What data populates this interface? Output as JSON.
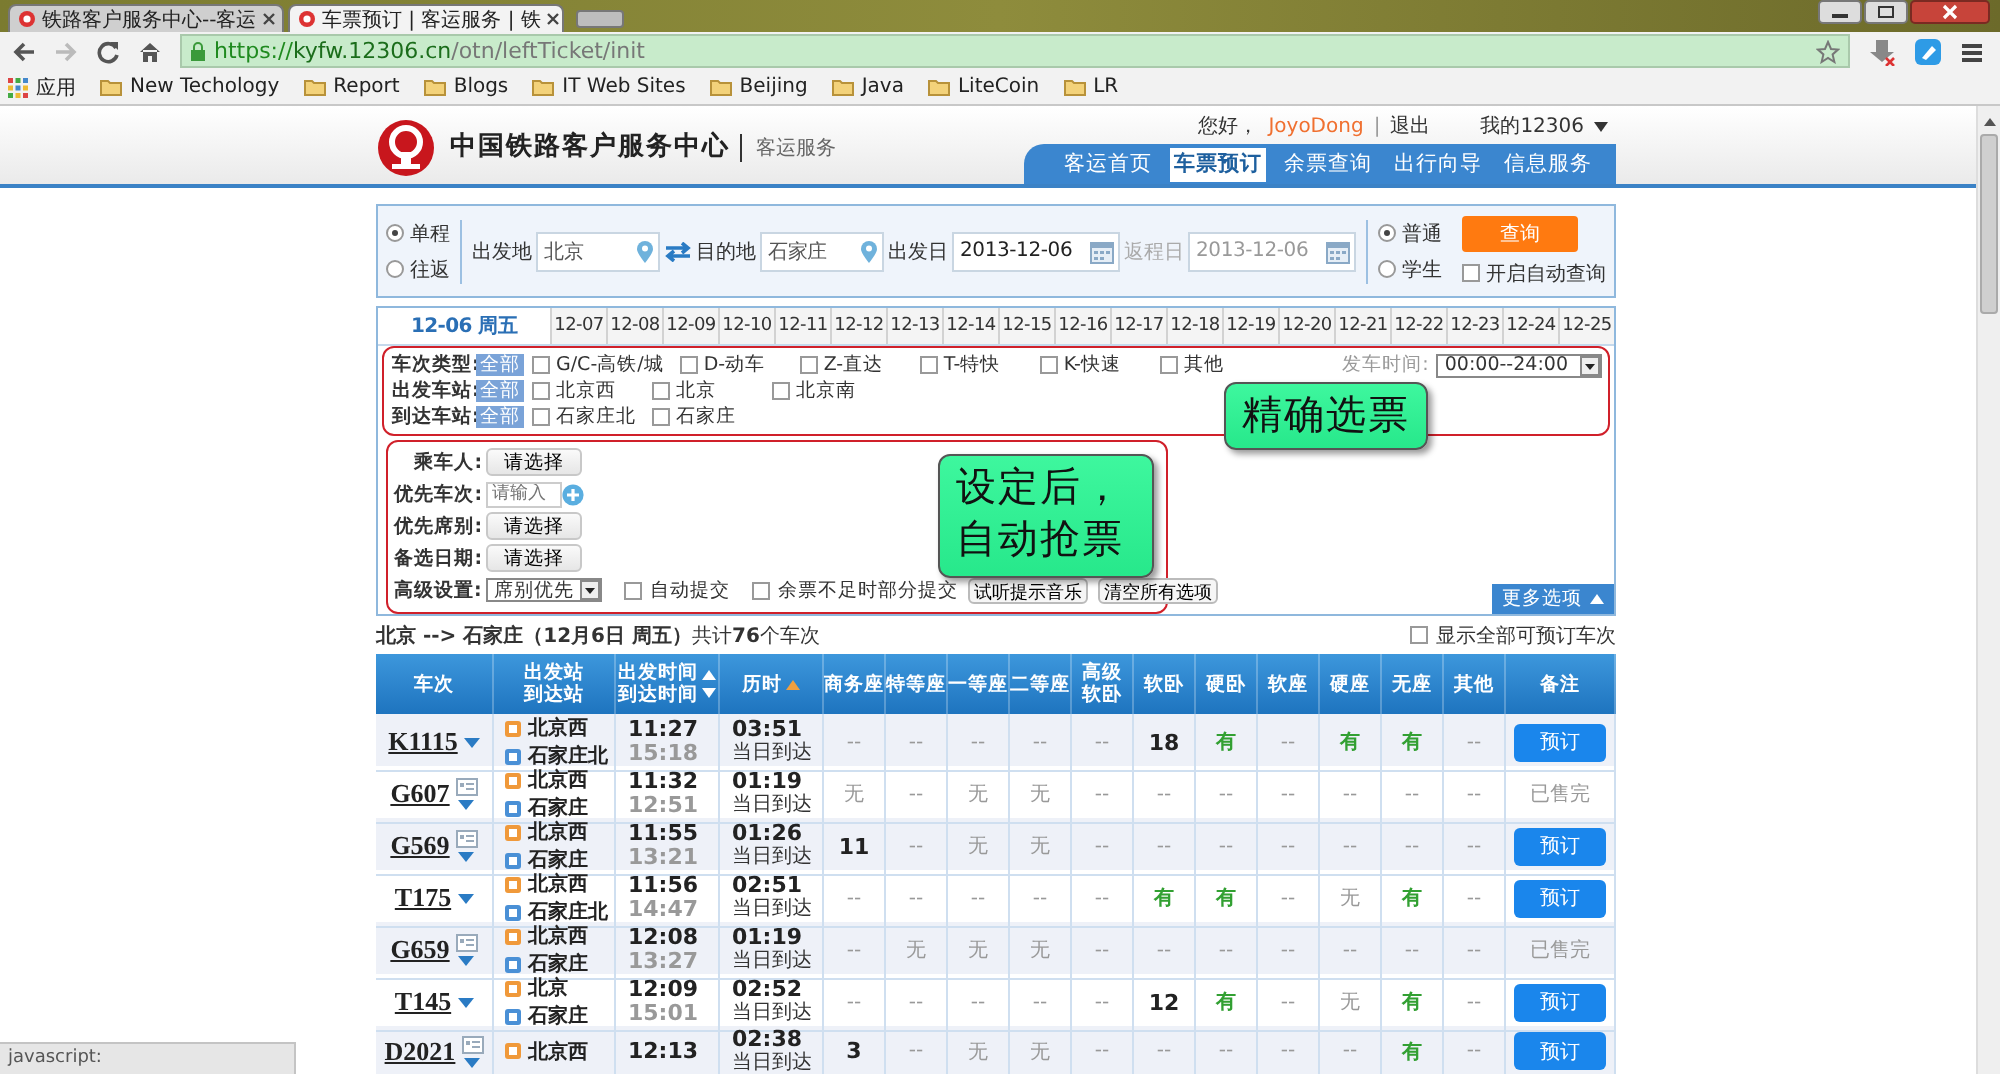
{
  "browser": {
    "tabs": [
      {
        "title": "铁路客户服务中心--客运",
        "selected": false
      },
      {
        "title": "车票预订 | 客运服务 | 铁",
        "selected": true
      }
    ],
    "url": {
      "scheme": "https://",
      "host": "kyfw.12306.cn",
      "path": "/otn/leftTicket/init"
    },
    "bookmarks": [
      "应用",
      "New Techology",
      "Report",
      "Blogs",
      "IT Web Sites",
      "Beijing",
      "Java",
      "LiteCoin",
      "LR"
    ]
  },
  "header": {
    "site_name": "中国铁路客户服务中心",
    "section": "客运服务",
    "greeting": "您好，",
    "user": "JoyoDong",
    "separator": "|",
    "logout": "退出",
    "account": "我的12306",
    "nav": [
      {
        "label": "客运首页",
        "selected": false
      },
      {
        "label": "车票预订",
        "selected": true
      },
      {
        "label": "余票查询",
        "selected": false
      },
      {
        "label": "出行向导",
        "selected": false
      },
      {
        "label": "信息服务",
        "selected": false
      }
    ]
  },
  "search": {
    "trip_types": [
      {
        "label": "单程",
        "selected": true
      },
      {
        "label": "往返",
        "selected": false
      }
    ],
    "from": {
      "label": "出发地",
      "value": "北京"
    },
    "to": {
      "label": "目的地",
      "value": "石家庄"
    },
    "depart_date": {
      "label": "出发日",
      "value": "2013-12-06",
      "disabled": false
    },
    "return_date": {
      "label": "返程日",
      "value": "2013-12-06",
      "disabled": true
    },
    "passenger_types": [
      {
        "label": "普通",
        "selected": true
      },
      {
        "label": "学生",
        "selected": false
      }
    ],
    "query_button": "查询",
    "auto_query": {
      "label": "开启自动查询",
      "checked": false
    }
  },
  "dates": [
    {
      "label": "12-06 周五",
      "selected": true
    },
    {
      "label": "12-07",
      "selected": false
    },
    {
      "label": "12-08",
      "selected": false
    },
    {
      "label": "12-09",
      "selected": false
    },
    {
      "label": "12-10",
      "selected": false
    },
    {
      "label": "12-11",
      "selected": false
    },
    {
      "label": "12-12",
      "selected": false
    },
    {
      "label": "12-13",
      "selected": false
    },
    {
      "label": "12-14",
      "selected": false
    },
    {
      "label": "12-15",
      "selected": false
    },
    {
      "label": "12-16",
      "selected": false
    },
    {
      "label": "12-17",
      "selected": false
    },
    {
      "label": "12-18",
      "selected": false
    },
    {
      "label": "12-19",
      "selected": false
    },
    {
      "label": "12-20",
      "selected": false
    },
    {
      "label": "12-21",
      "selected": false
    },
    {
      "label": "12-22",
      "selected": false
    },
    {
      "label": "12-23",
      "selected": false
    },
    {
      "label": "12-24",
      "selected": false
    },
    {
      "label": "12-25",
      "selected": false
    }
  ],
  "filters": {
    "highlighted": true,
    "callout": "精确选票",
    "rows": [
      {
        "label": "车次类型:",
        "all": "全部",
        "options": [
          {
            "label": "G/C-高铁/城",
            "checked": false
          },
          {
            "label": "D-动车",
            "checked": false
          },
          {
            "label": "Z-直达",
            "checked": false
          },
          {
            "label": "T-特快",
            "checked": false
          },
          {
            "label": "K-快速",
            "checked": false
          },
          {
            "label": "其他",
            "checked": false
          }
        ]
      },
      {
        "label": "出发车站:",
        "all": "全部",
        "options": [
          {
            "label": "北京西",
            "checked": false
          },
          {
            "label": "北京",
            "checked": false
          },
          {
            "label": "北京南",
            "checked": false
          }
        ]
      },
      {
        "label": "到达车站:",
        "all": "全部",
        "options": [
          {
            "label": "石家庄北",
            "checked": false
          },
          {
            "label": "石家庄",
            "checked": false
          }
        ]
      }
    ],
    "time": {
      "label": "发车时间:",
      "value": "00:00--24:00"
    }
  },
  "options": {
    "highlighted": true,
    "callout": [
      "设定后，",
      "自动抢票"
    ],
    "more": "更多选项",
    "rows": [
      {
        "kind": "button",
        "label": "乘车人:",
        "button": "请选择"
      },
      {
        "kind": "input",
        "label": "优先车次:",
        "placeholder": "请输入"
      },
      {
        "kind": "button",
        "label": "优先席别:",
        "button": "请选择"
      },
      {
        "kind": "button",
        "label": "备选日期:",
        "button": "请选择"
      },
      {
        "kind": "advanced",
        "label": "高级设置:",
        "select": "席别优先",
        "checks": [
          {
            "label": "自动提交",
            "checked": false
          },
          {
            "label": "余票不足时部分提交",
            "checked": false
          }
        ],
        "buttons": [
          "试听提示音乐",
          "清空所有选项"
        ]
      }
    ]
  },
  "route": {
    "summary": "**北京 --> 石家庄（12月6日  周五）**共计**76**个车次",
    "show_all": {
      "label": "显示全部可预订车次",
      "checked": false
    }
  },
  "table": {
    "columns": [
      {
        "lines": [
          "车次"
        ]
      },
      {
        "lines": [
          "出发站",
          "到达站"
        ]
      },
      {
        "lines": [
          "出发时间",
          "到达时间"
        ],
        "sort_up": true,
        "sort_down": true,
        "sort_active": false
      },
      {
        "lines": [
          "历时"
        ],
        "sort_up": true,
        "sort_active": true
      },
      {
        "lines": [
          "商务座"
        ]
      },
      {
        "lines": [
          "特等座"
        ]
      },
      {
        "lines": [
          "一等座"
        ]
      },
      {
        "lines": [
          "二等座"
        ]
      },
      {
        "lines": [
          "高级",
          "软卧"
        ]
      },
      {
        "lines": [
          "软卧"
        ]
      },
      {
        "lines": [
          "硬卧"
        ]
      },
      {
        "lines": [
          "软座"
        ]
      },
      {
        "lines": [
          "硬座"
        ]
      },
      {
        "lines": [
          "无座"
        ]
      },
      {
        "lines": [
          "其他"
        ]
      },
      {
        "lines": [
          "备注"
        ]
      }
    ],
    "rows": [
      {
        "train": "K1115",
        "stops_icon": false,
        "from": "北京西",
        "to": "石家庄北",
        "depart": "11:27",
        "arrive": "15:18",
        "duration": "03:51",
        "arrival_day": "当日到达",
        "seats": [
          {
            "text": "--",
            "kind": "none"
          },
          {
            "text": "--",
            "kind": "none"
          },
          {
            "text": "--",
            "kind": "none"
          },
          {
            "text": "--",
            "kind": "none"
          },
          {
            "text": "--",
            "kind": "none"
          },
          {
            "text": "18",
            "kind": "count"
          },
          {
            "text": "有",
            "kind": "yes"
          },
          {
            "text": "--",
            "kind": "none"
          },
          {
            "text": "有",
            "kind": "yes"
          },
          {
            "text": "有",
            "kind": "yes"
          },
          {
            "text": "--",
            "kind": "none"
          }
        ],
        "action": {
          "kind": "button",
          "text": "预订"
        }
      },
      {
        "train": "G607",
        "stops_icon": true,
        "from": "北京西",
        "to": "石家庄",
        "depart": "11:32",
        "arrive": "12:51",
        "duration": "01:19",
        "arrival_day": "当日到达",
        "seats": [
          {
            "text": "无",
            "kind": "none"
          },
          {
            "text": "--",
            "kind": "none"
          },
          {
            "text": "无",
            "kind": "none"
          },
          {
            "text": "无",
            "kind": "none"
          },
          {
            "text": "--",
            "kind": "none"
          },
          {
            "text": "--",
            "kind": "none"
          },
          {
            "text": "--",
            "kind": "none"
          },
          {
            "text": "--",
            "kind": "none"
          },
          {
            "text": "--",
            "kind": "none"
          },
          {
            "text": "--",
            "kind": "none"
          },
          {
            "text": "--",
            "kind": "none"
          }
        ],
        "action": {
          "kind": "sold_out",
          "text": "已售完"
        }
      },
      {
        "train": "G569",
        "stops_icon": true,
        "from": "北京西",
        "to": "石家庄",
        "depart": "11:55",
        "arrive": "13:21",
        "duration": "01:26",
        "arrival_day": "当日到达",
        "seats": [
          {
            "text": "11",
            "kind": "count"
          },
          {
            "text": "--",
            "kind": "none"
          },
          {
            "text": "无",
            "kind": "none"
          },
          {
            "text": "无",
            "kind": "none"
          },
          {
            "text": "--",
            "kind": "none"
          },
          {
            "text": "--",
            "kind": "none"
          },
          {
            "text": "--",
            "kind": "none"
          },
          {
            "text": "--",
            "kind": "none"
          },
          {
            "text": "--",
            "kind": "none"
          },
          {
            "text": "--",
            "kind": "none"
          },
          {
            "text": "--",
            "kind": "none"
          }
        ],
        "action": {
          "kind": "button",
          "text": "预订"
        }
      },
      {
        "train": "T175",
        "stops_icon": false,
        "from": "北京西",
        "to": "石家庄北",
        "depart": "11:56",
        "arrive": "14:47",
        "duration": "02:51",
        "arrival_day": "当日到达",
        "seats": [
          {
            "text": "--",
            "kind": "none"
          },
          {
            "text": "--",
            "kind": "none"
          },
          {
            "text": "--",
            "kind": "none"
          },
          {
            "text": "--",
            "kind": "none"
          },
          {
            "text": "--",
            "kind": "none"
          },
          {
            "text": "有",
            "kind": "yes"
          },
          {
            "text": "有",
            "kind": "yes"
          },
          {
            "text": "--",
            "kind": "none"
          },
          {
            "text": "无",
            "kind": "none"
          },
          {
            "text": "有",
            "kind": "yes"
          },
          {
            "text": "--",
            "kind": "none"
          }
        ],
        "action": {
          "kind": "button",
          "text": "预订"
        }
      },
      {
        "train": "G659",
        "stops_icon": true,
        "from": "北京西",
        "to": "石家庄",
        "depart": "12:08",
        "arrive": "13:27",
        "duration": "01:19",
        "arrival_day": "当日到达",
        "seats": [
          {
            "text": "--",
            "kind": "none"
          },
          {
            "text": "无",
            "kind": "none"
          },
          {
            "text": "无",
            "kind": "none"
          },
          {
            "text": "无",
            "kind": "none"
          },
          {
            "text": "--",
            "kind": "none"
          },
          {
            "text": "--",
            "kind": "none"
          },
          {
            "text": "--",
            "kind": "none"
          },
          {
            "text": "--",
            "kind": "none"
          },
          {
            "text": "--",
            "kind": "none"
          },
          {
            "text": "--",
            "kind": "none"
          },
          {
            "text": "--",
            "kind": "none"
          }
        ],
        "action": {
          "kind": "sold_out",
          "text": "已售完"
        }
      },
      {
        "train": "T145",
        "stops_icon": false,
        "from": "北京",
        "to": "石家庄",
        "depart": "12:09",
        "arrive": "15:01",
        "duration": "02:52",
        "arrival_day": "当日到达",
        "seats": [
          {
            "text": "--",
            "kind": "none"
          },
          {
            "text": "--",
            "kind": "none"
          },
          {
            "text": "--",
            "kind": "none"
          },
          {
            "text": "--",
            "kind": "none"
          },
          {
            "text": "--",
            "kind": "none"
          },
          {
            "text": "12",
            "kind": "count"
          },
          {
            "text": "有",
            "kind": "yes"
          },
          {
            "text": "--",
            "kind": "none"
          },
          {
            "text": "无",
            "kind": "none"
          },
          {
            "text": "有",
            "kind": "yes"
          },
          {
            "text": "--",
            "kind": "none"
          }
        ],
        "action": {
          "kind": "button",
          "text": "预订"
        }
      },
      {
        "train": "D2021",
        "stops_icon": true,
        "from": "北京西",
        "depart": "12:13",
        "duration": "02:38",
        "arrival_day": "当日到达",
        "seats": [
          {
            "text": "3",
            "kind": "count"
          },
          {
            "text": "--",
            "kind": "none"
          },
          {
            "text": "无",
            "kind": "none"
          },
          {
            "text": "无",
            "kind": "none"
          },
          {
            "text": "--",
            "kind": "none"
          },
          {
            "text": "--",
            "kind": "none"
          },
          {
            "text": "--",
            "kind": "none"
          },
          {
            "text": "--",
            "kind": "none"
          },
          {
            "text": "--",
            "kind": "none"
          },
          {
            "text": "有",
            "kind": "yes"
          },
          {
            "text": "--",
            "kind": "none"
          }
        ],
        "action": {
          "kind": "button",
          "text": "预订"
        }
      }
    ]
  },
  "status_bar": "javascript:"
}
